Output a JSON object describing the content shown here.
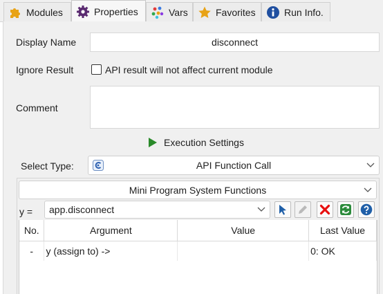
{
  "tabs": [
    {
      "label": "Modules",
      "icon": "puzzle-icon"
    },
    {
      "label": "Properties",
      "icon": "gear-icon"
    },
    {
      "label": "Vars",
      "icon": "dots-icon"
    },
    {
      "label": "Favorites",
      "icon": "star-icon"
    },
    {
      "label": "Run Info.",
      "icon": "info-icon"
    }
  ],
  "active_tab": "Properties",
  "form": {
    "display_name_label": "Display Name",
    "display_name_value": "disconnect",
    "ignore_result_label": "Ignore Result",
    "ignore_result_checkbox_label": "API result will not affect current module",
    "ignore_result_checked": false,
    "comment_label": "Comment",
    "comment_value": "",
    "execution_settings_label": "Execution Settings",
    "select_type_label": "Select Type:",
    "select_type_value": "API Function Call",
    "category_value": "Mini Program System Functions",
    "assign_label": "y =",
    "function_value": "app.disconnect"
  },
  "table": {
    "headers": [
      "No.",
      "Argument",
      "Value",
      "Last Value"
    ],
    "rows": [
      {
        "no": "-",
        "argument": "y (assign to) ->",
        "value": "",
        "last_value": "0: OK"
      }
    ]
  },
  "colors": {
    "play": "#2a8a2a",
    "cursor_icon": "#1f5fa8",
    "delete_icon": "#e81010",
    "refresh_icon": "#2a8a3a",
    "help_icon": "#1f5fa8",
    "info_icon": "#1f4fa0",
    "star_icon": "#e8a317",
    "puzzle_icon": "#e8a317",
    "gear_icon": "#5a2a70"
  }
}
